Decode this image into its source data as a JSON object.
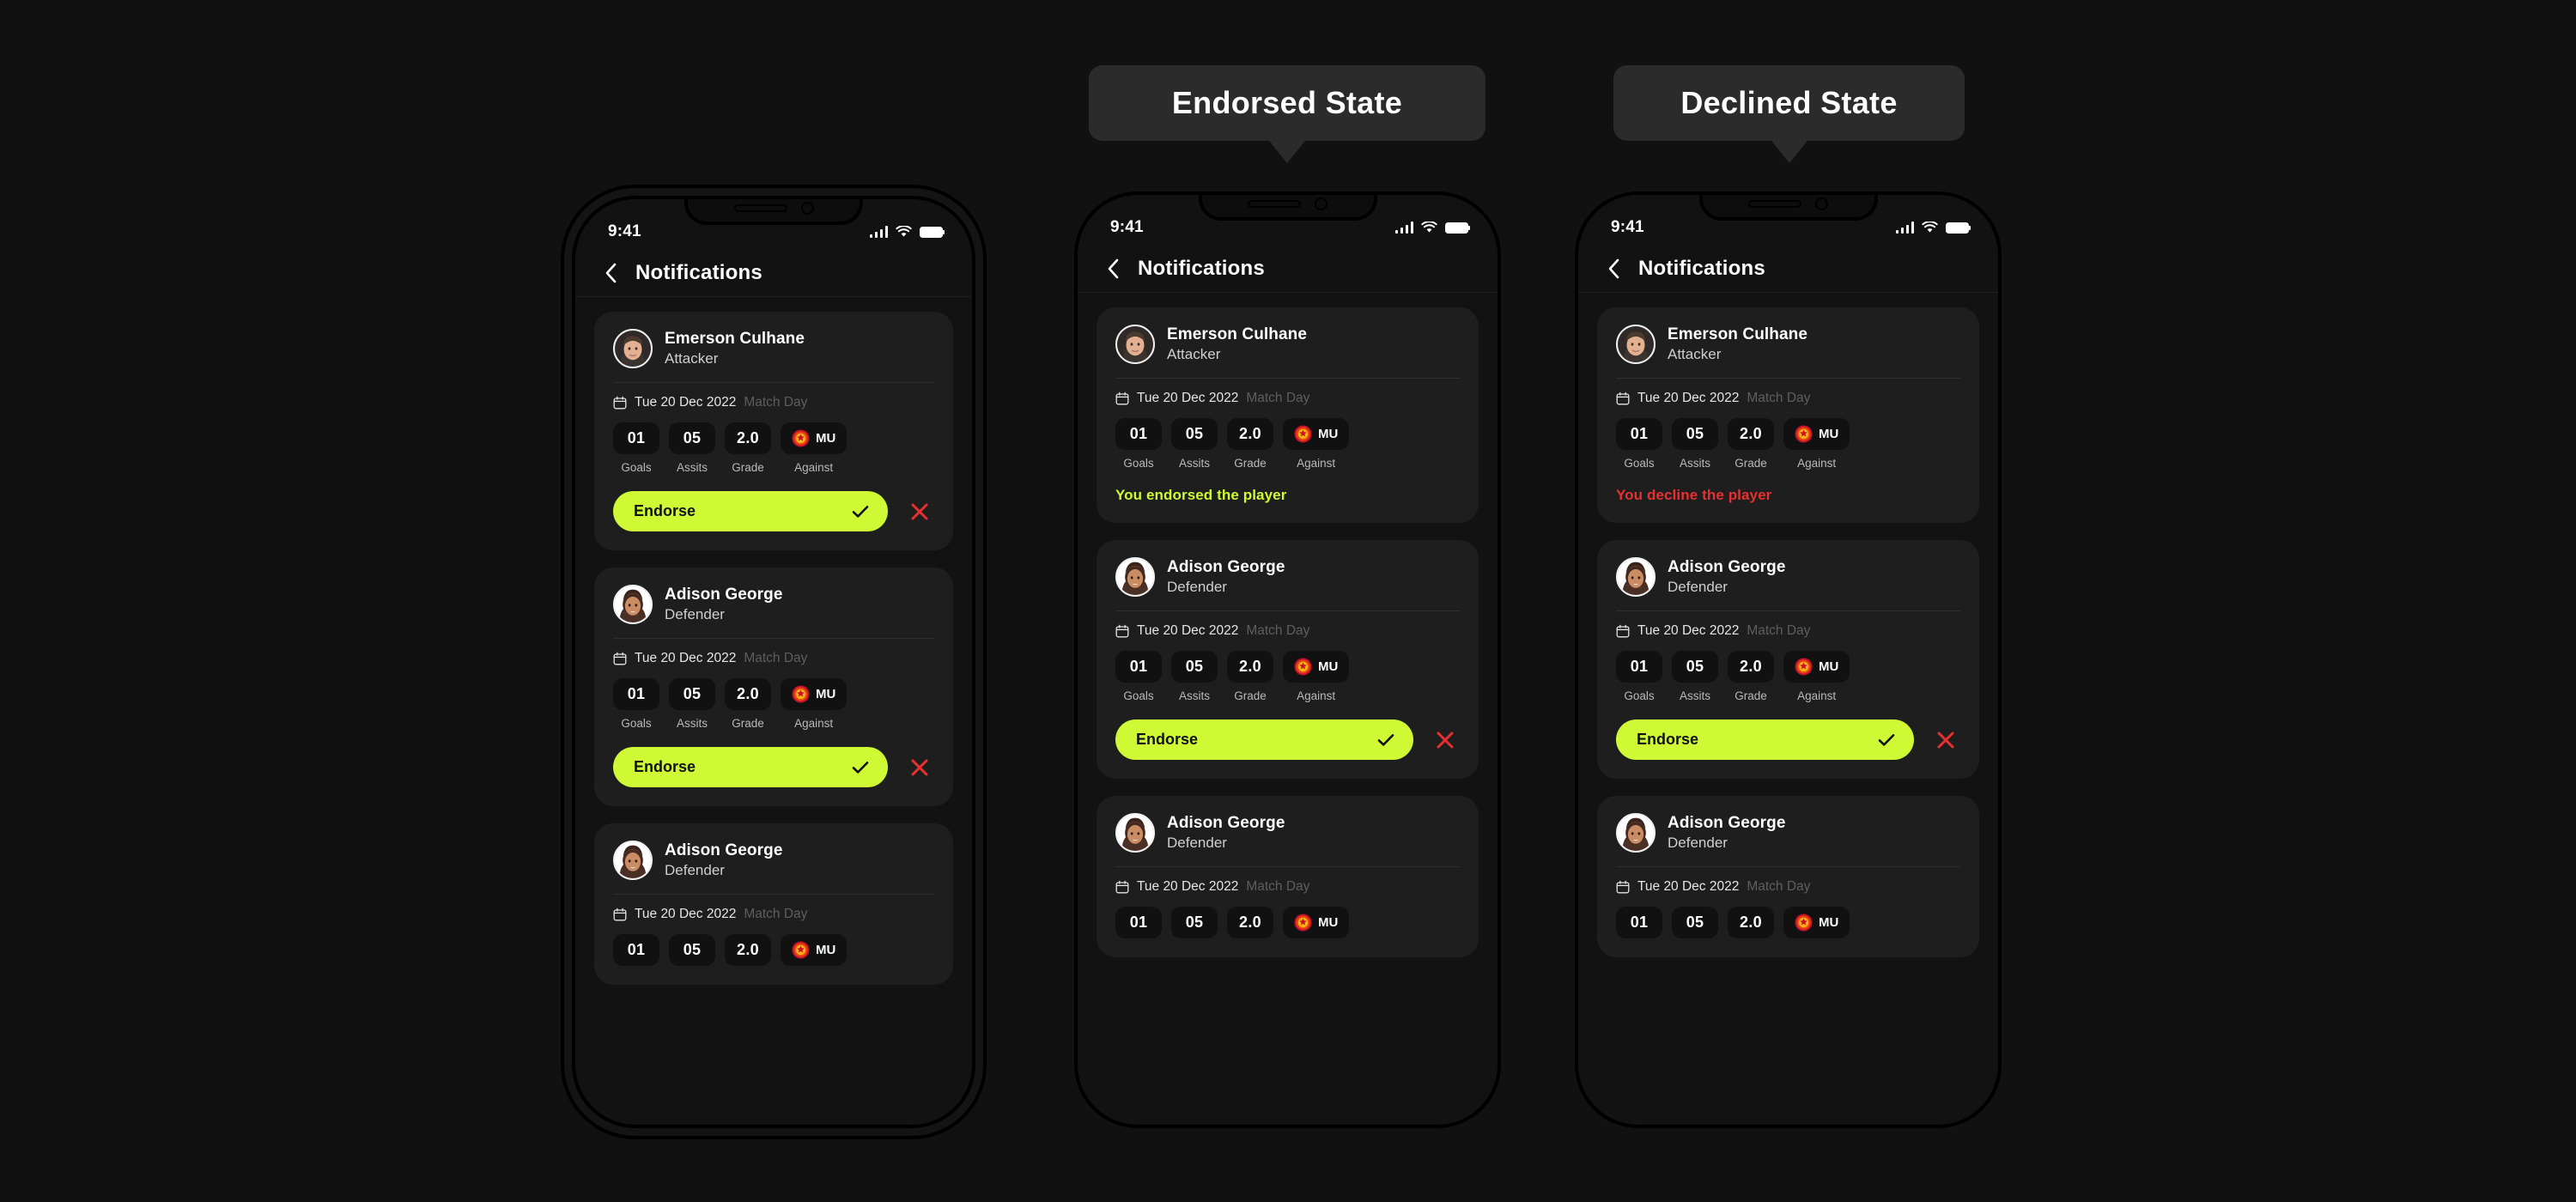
{
  "background_color": "#111111",
  "accent_endorse_color": "#d0f935",
  "accent_decline_color": "#e83030",
  "callouts": [
    {
      "label": "Endorsed State"
    },
    {
      "label": "Declined State"
    }
  ],
  "status_bar": {
    "time": "9:41",
    "icons": [
      "signal-bars-icon",
      "wifi-icon",
      "battery-icon"
    ]
  },
  "nav": {
    "back_icon": "chevron-left-icon",
    "title": "Notifications"
  },
  "labels": {
    "endorse_button": "Endorse",
    "check_icon": "check-icon",
    "close_icon": "close-icon",
    "calendar_icon": "calendar-icon",
    "match_day": "Match Day",
    "date": "Tue 20 Dec 2022",
    "endorsed_message": "You endorsed the player",
    "declined_message": "You decline the player"
  },
  "stat_labels": [
    "Goals",
    "Assits",
    "Grade",
    "Against"
  ],
  "players": {
    "emerson": {
      "name": "Emerson Culhane",
      "role": "Attacker",
      "avatar": "male-avatar"
    },
    "adison": {
      "name": "Adison George",
      "role": "Defender",
      "avatar": "female-avatar"
    }
  },
  "stats": {
    "goals": "01",
    "assists": "05",
    "grade": "2.0",
    "against_club": "MU",
    "against_crest": "manchester-united-crest-icon"
  },
  "phones": [
    {
      "id": "default-state",
      "cards": [
        {
          "player": "emerson",
          "action": "buttons"
        },
        {
          "player": "adison",
          "action": "buttons"
        },
        {
          "player": "adison",
          "action": "clipped-header"
        }
      ]
    },
    {
      "id": "endorsed-state",
      "cards": [
        {
          "player": "emerson",
          "action": "endorsed-message"
        },
        {
          "player": "adison",
          "action": "buttons"
        },
        {
          "player": "adison",
          "action": "clipped-stats"
        }
      ]
    },
    {
      "id": "declined-state",
      "cards": [
        {
          "player": "emerson",
          "action": "declined-message"
        },
        {
          "player": "adison",
          "action": "buttons"
        },
        {
          "player": "adison",
          "action": "clipped-stats"
        }
      ]
    }
  ]
}
